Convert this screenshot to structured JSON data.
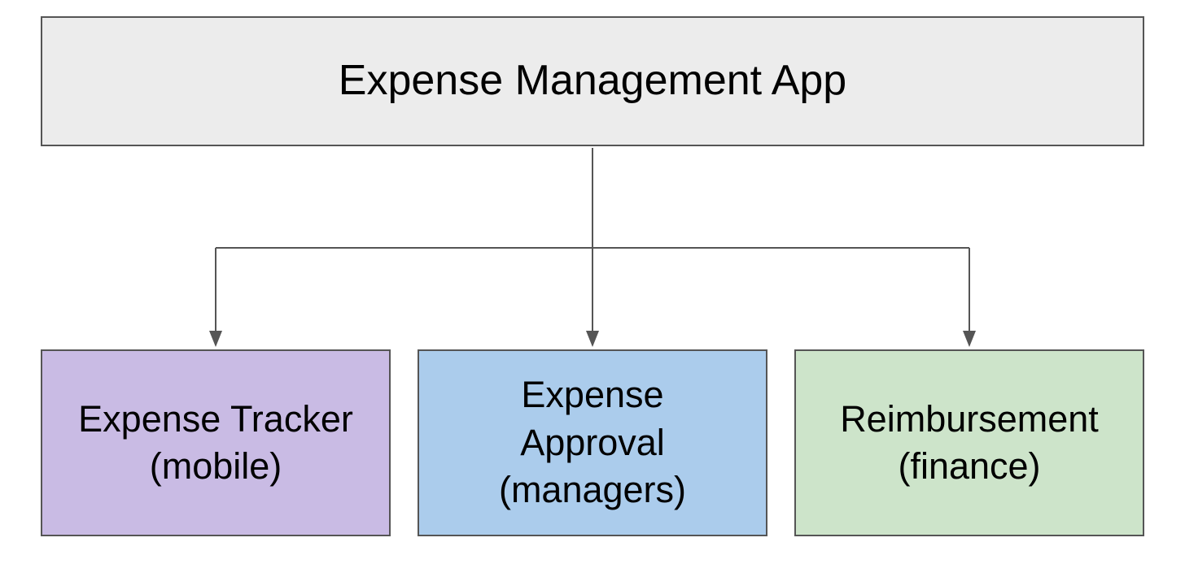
{
  "diagram": {
    "root": {
      "label": "Expense Management App",
      "color": "#ececec"
    },
    "children": [
      {
        "label": "Expense Tracker\n(mobile)",
        "color": "#c9bbe4"
      },
      {
        "label": "Expense\nApproval\n(managers)",
        "color": "#abccec"
      },
      {
        "label": "Reimbursement\n(finance)",
        "color": "#cde4ca"
      }
    ]
  }
}
